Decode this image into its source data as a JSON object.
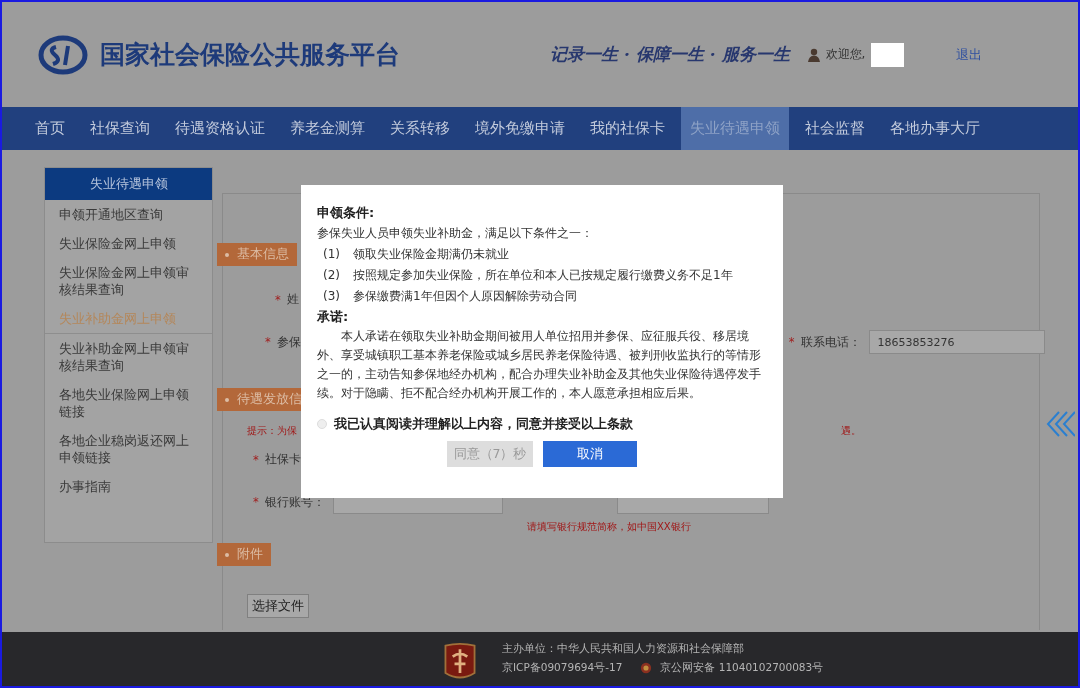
{
  "header": {
    "site_title": "国家社会保险公共服务平台",
    "slogan": "记录一生 · 保障一生 · 服务一生",
    "welcome": "欢迎您,",
    "logout": "退出"
  },
  "nav": [
    {
      "label": "首页",
      "selected": false
    },
    {
      "label": "社保查询",
      "selected": false
    },
    {
      "label": "待遇资格认证",
      "selected": false
    },
    {
      "label": "养老金测算",
      "selected": false
    },
    {
      "label": "关系转移",
      "selected": false
    },
    {
      "label": "境外免缴申请",
      "selected": false
    },
    {
      "label": "我的社保卡",
      "selected": false
    },
    {
      "label": "失业待遇申领",
      "selected": true
    },
    {
      "label": "社会监督",
      "selected": false
    },
    {
      "label": "各地办事大厅",
      "selected": false
    }
  ],
  "sidebar": {
    "title": "失业待遇申领",
    "items": [
      {
        "label": "申领开通地区查询",
        "selected": false
      },
      {
        "label": "失业保险金网上申领",
        "selected": false
      },
      {
        "label": "失业保险金网上申领审核结果查询",
        "selected": false
      },
      {
        "label": "失业补助金网上申领",
        "selected": true
      },
      {
        "label": "失业补助金网上申领审核结果查询",
        "selected": false
      },
      {
        "label": "各地失业保险网上申领链接",
        "selected": false
      },
      {
        "label": "各地企业稳岗返还网上申领链接",
        "selected": false
      },
      {
        "label": "办事指南",
        "selected": false
      }
    ]
  },
  "form": {
    "basic_info": {
      "tag": "基本信息",
      "name_mark": "*",
      "name_label": "姓",
      "insured_mark": "*",
      "insured_label": "参保",
      "phone_mark": "*",
      "phone_label": "联系电话：",
      "phone_value": "18653853276"
    },
    "payment_info": {
      "tag": "待遇发放信",
      "hint": "提示：为保",
      "hint_end": "遇。",
      "card_mark": "*",
      "card_label": "社保卡",
      "account_mark": "*",
      "account_label": "银行账号：",
      "bank_hint": "请填写银行规范简称，如中国XX银行"
    },
    "attachments": {
      "tag": "附件",
      "choose_file": "选择文件"
    }
  },
  "modal": {
    "conditions_title": "申领条件:",
    "intro": "参保失业人员申领失业补助金，满足以下条件之一：",
    "conditions": [
      {
        "number": "(1)",
        "text": "领取失业保险金期满仍未就业"
      },
      {
        "number": "(2)",
        "text": "按照规定参加失业保险，所在单位和本人已按规定履行缴费义务不足1年"
      },
      {
        "number": "(3)",
        "text": "参保缴费满1年但因个人原因解除劳动合同"
      }
    ],
    "promise_title": "承诺:",
    "promise_text": "本人承诺在领取失业补助金期间被用人单位招用并参保、应征服兵役、移居境外、享受城镇职工基本养老保险或城乡居民养老保险待遇、被判刑收监执行的等情形之一的，主动告知参保地经办机构，配合办理失业补助金及其他失业保险待遇停发手续。对于隐瞒、拒不配合经办机构开展工作的，本人愿意承担相应后果。",
    "agree_label": "我已认真阅读并理解以上内容，同意并接受以上条款",
    "agree_checked": false,
    "agree_button": {
      "label": "同意（7）秒",
      "disabled": true
    },
    "cancel_button": {
      "label": "取消",
      "disabled": false
    }
  },
  "footer": {
    "sponsor": "主办单位：中华人民共和国人力资源和社会保障部",
    "icp": "京ICP备09079694号-17",
    "police": "京公网安备 11040102700083号"
  }
}
